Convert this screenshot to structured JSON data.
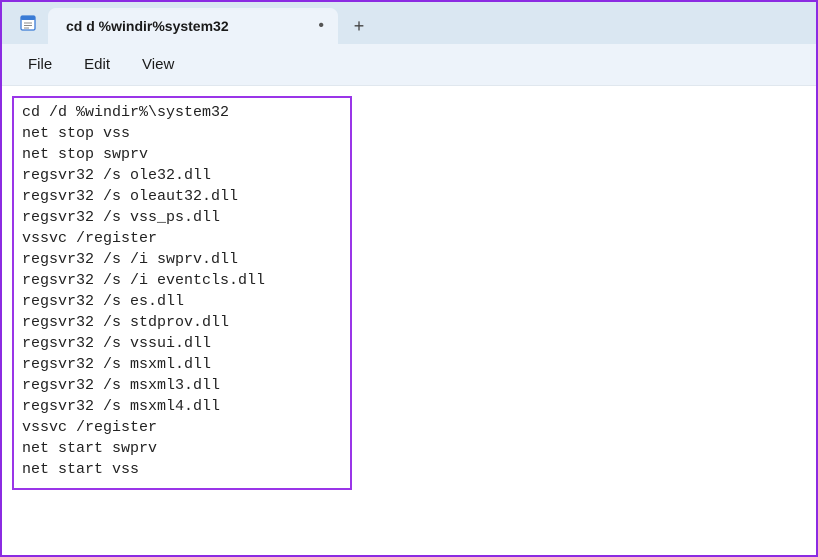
{
  "titlebar": {
    "tab": {
      "title": "cd d %windir%system32",
      "dirty_indicator": "•"
    },
    "new_tab_glyph": "+"
  },
  "menubar": {
    "items": [
      "File",
      "Edit",
      "View"
    ]
  },
  "document": {
    "lines": [
      "cd /d %windir%\\system32",
      "net stop vss",
      "net stop swprv",
      "regsvr32 /s ole32.dll",
      "regsvr32 /s oleaut32.dll",
      "regsvr32 /s vss_ps.dll",
      "vssvc /register",
      "regsvr32 /s /i swprv.dll",
      "regsvr32 /s /i eventcls.dll",
      "regsvr32 /s es.dll",
      "regsvr32 /s stdprov.dll",
      "regsvr32 /s vssui.dll",
      "regsvr32 /s msxml.dll",
      "regsvr32 /s msxml3.dll",
      "regsvr32 /s msxml4.dll",
      "vssvc /register",
      "net start swprv",
      "net start vss"
    ]
  }
}
